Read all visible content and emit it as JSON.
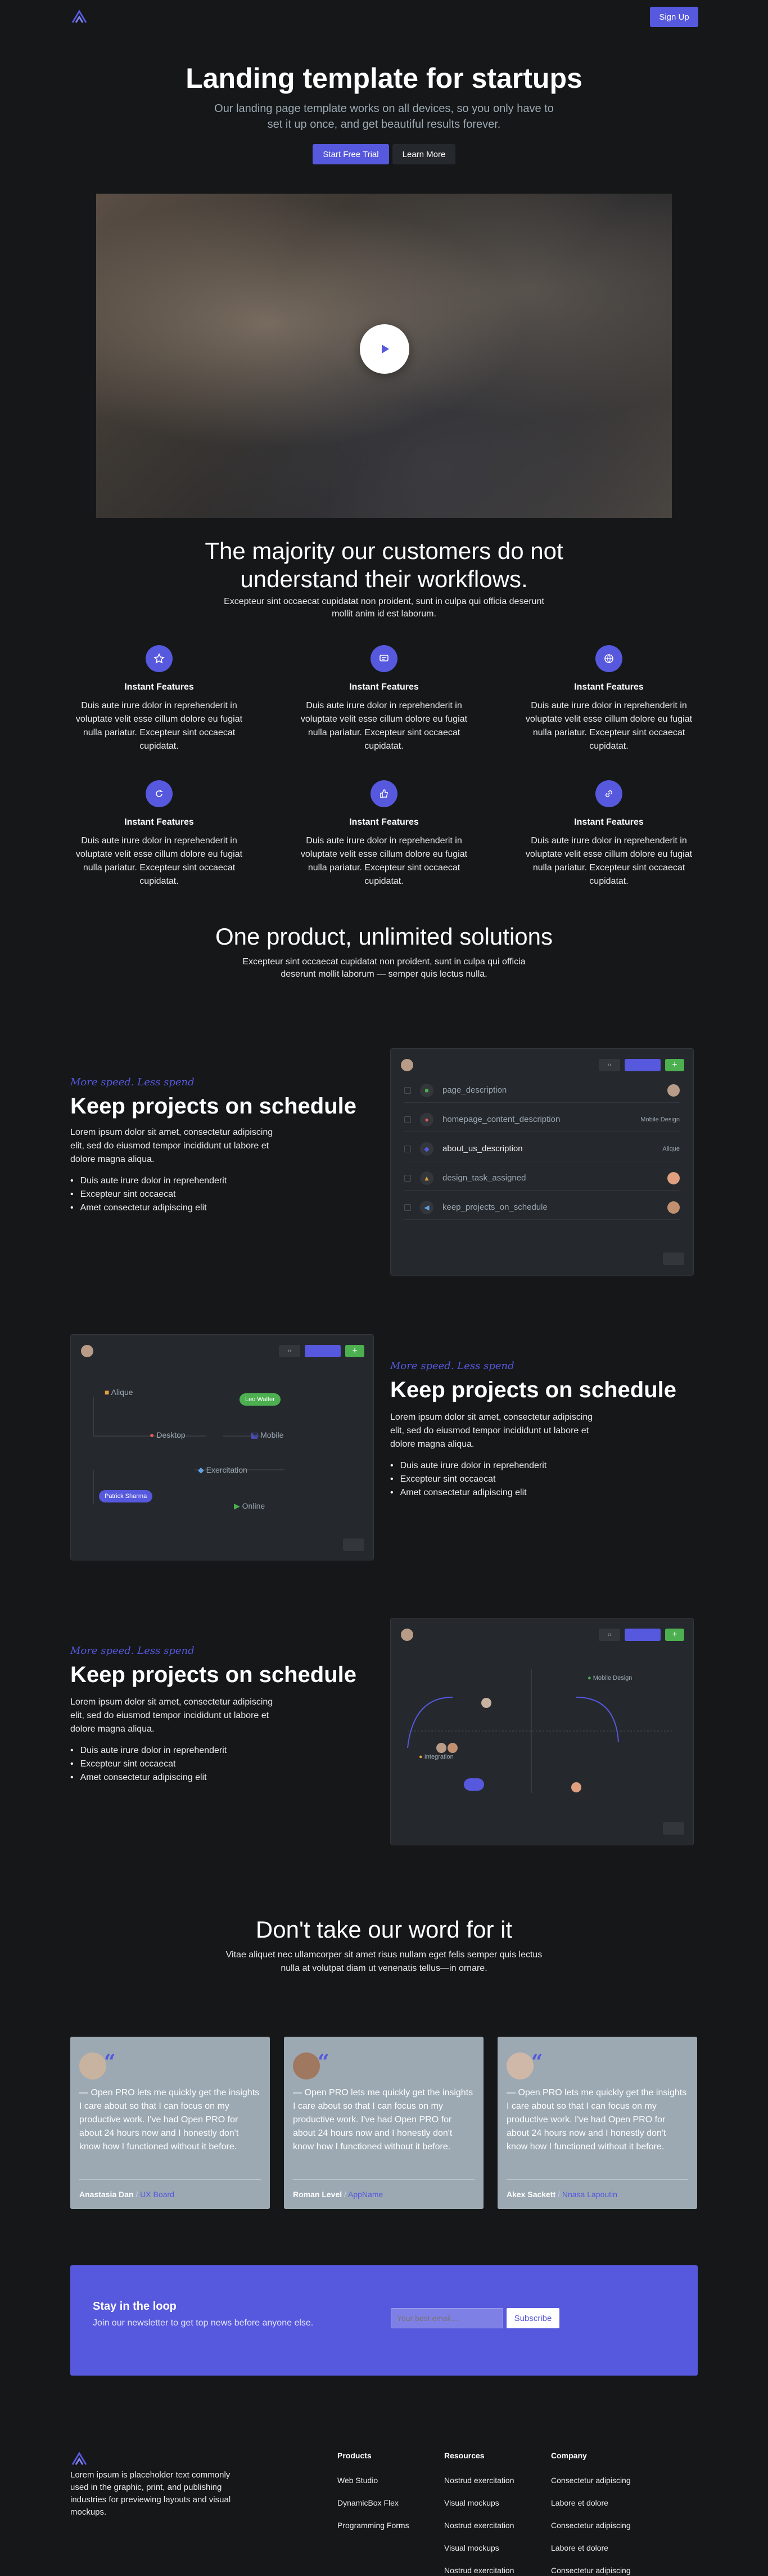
{
  "header": {
    "signup_label": "Sign Up"
  },
  "hero": {
    "title": "Landing template for startups",
    "subtitle_line1": "Our landing page template works on all devices, so you only have to",
    "subtitle_line2": "set it up once, and get beautiful results forever.",
    "cta_primary": "Start Free Trial",
    "cta_secondary": "Learn More"
  },
  "features": {
    "title_line1": "The majority our customers do not",
    "title_line2": "understand their workflows.",
    "desc_line1": "Excepteur sint occaecat cupidatat non proident, sunt in culpa qui officia deserunt",
    "desc_line2": "mollit anim id est laborum.",
    "items": [
      {
        "title": "Instant Features",
        "desc": "Duis aute irure dolor in reprehenderit in voluptate velit esse cillum dolore eu fugiat nulla pariatur. Excepteur sint occaecat cupidatat."
      },
      {
        "title": "Instant Features",
        "desc": "Duis aute irure dolor in reprehenderit in voluptate velit esse cillum dolore eu fugiat nulla pariatur. Excepteur sint occaecat cupidatat."
      },
      {
        "title": "Instant Features",
        "desc": "Duis aute irure dolor in reprehenderit in voluptate velit esse cillum dolore eu fugiat nulla pariatur. Excepteur sint occaecat cupidatat."
      },
      {
        "title": "Instant Features",
        "desc": "Duis aute irure dolor in reprehenderit in voluptate velit esse cillum dolore eu fugiat nulla pariatur. Excepteur sint occaecat cupidatat."
      },
      {
        "title": "Instant Features",
        "desc": "Duis aute irure dolor in reprehenderit in voluptate velit esse cillum dolore eu fugiat nulla pariatur. Excepteur sint occaecat cupidatat."
      },
      {
        "title": "Instant Features",
        "desc": "Duis aute irure dolor in reprehenderit in voluptate velit esse cillum dolore eu fugiat nulla pariatur. Excepteur sint occaecat cupidatat."
      }
    ]
  },
  "solutions": {
    "title": "One product, unlimited solutions",
    "desc_line1": "Excepteur sint occaecat cupidatat non proident, sunt in culpa qui officia",
    "desc_line2": "deserunt mollit laborum — semper quis lectus nulla."
  },
  "splits": [
    {
      "eyebrow": "More speed. Less spend",
      "title": "Keep projects on schedule",
      "p_line1": "Lorem ipsum dolor sit amet, consectetur adipiscing",
      "p_line2": "elit, sed do eiusmod tempor incididunt ut labore et",
      "p_line3": "dolore magna aliqua.",
      "bullets": [
        "Duis aute irure dolor in reprehenderit",
        "Excepteur sint occaecat",
        "Amet consectetur adipiscing elit"
      ]
    },
    {
      "eyebrow": "More speed. Less spend",
      "title": "Keep projects on schedule",
      "p_line1": "Lorem ipsum dolor sit amet, consectetur adipiscing",
      "p_line2": "elit, sed do eiusmod tempor incididunt ut labore et",
      "p_line3": "dolore magna aliqua.",
      "bullets": [
        "Duis aute irure dolor in reprehenderit",
        "Excepteur sint occaecat",
        "Amet consectetur adipiscing elit"
      ]
    },
    {
      "eyebrow": "More speed. Less spend",
      "title": "Keep projects on schedule",
      "p_line1": "Lorem ipsum dolor sit amet, consectetur adipiscing",
      "p_line2": "elit, sed do eiusmod tempor incididunt ut labore et",
      "p_line3": "dolore magna aliqua.",
      "bullets": [
        "Duis aute irure dolor in reprehenderit",
        "Excepteur sint occaecat",
        "Amet consectetur adipiscing elit"
      ]
    }
  ],
  "panel1": {
    "rows": [
      "page_description",
      "homepage_content_description",
      "about_us_description",
      "design_task_assigned",
      "keep_projects_on_schedule"
    ],
    "tag_mobile": "Mobile Design",
    "tag_alique": "Alique"
  },
  "panel2": {
    "node_alique": "Alique",
    "node_desktop": "Desktop",
    "node_mobile": "Mobile",
    "node_exercitation": "Exercitation",
    "node_online": "Online",
    "badge_leo": "Leo Walter",
    "badge_patrick": "Patrick Sharma"
  },
  "panel3": {
    "tag_mobile": "Mobile Design",
    "tag_integration": "Integration"
  },
  "testimonials": {
    "title": "Don't take our word for it",
    "desc_line1": "Vitae aliquet nec ullamcorper sit amet risus nullam eget felis semper quis lectus",
    "desc_line2": "nulla at volutpat diam ut venenatis tellus—in ornare.",
    "items": [
      {
        "quote": "— Open PRO lets me quickly get the insights I care about so that I can focus on my productive work. I've had Open PRO for about 24 hours now and I honestly don't know how I functioned without it before.",
        "name": "Anastasia Dan",
        "company": "UX Board"
      },
      {
        "quote": "— Open PRO lets me quickly get the insights I care about so that I can focus on my productive work. I've had Open PRO for about 24 hours now and I honestly don't know how I functioned without it before.",
        "name": "Roman Level",
        "company": "AppName"
      },
      {
        "quote": "— Open PRO lets me quickly get the insights I care about so that I can focus on my productive work. I've had Open PRO for about 24 hours now and I honestly don't know how I functioned without it before.",
        "name": "Akex Sackett",
        "company": "Nnasa Lapoutin"
      }
    ]
  },
  "newsletter": {
    "title": "Stay in the loop",
    "desc": "Join our newsletter to get top news before anyone else.",
    "placeholder": "Your best email…",
    "button": "Subscribe"
  },
  "footer": {
    "blurb_line1": "Lorem ipsum is placeholder text commonly",
    "blurb_line2": "used in the graphic, print, and publishing",
    "blurb_line3": "industries for previewing layouts and visual",
    "blurb_line4": "mockups.",
    "products": {
      "title": "Products",
      "links": [
        "Web Studio",
        "DynamicBox Flex",
        "Programming Forms"
      ]
    },
    "resources": {
      "title": "Resources",
      "links": [
        "Nostrud exercitation",
        "Visual mockups",
        "Nostrud exercitation",
        "Visual mockups",
        "Nostrud exercitation"
      ]
    },
    "company": {
      "title": "Company",
      "links": [
        "Consectetur adipiscing",
        "Labore et dolore",
        "Consectetur adipiscing",
        "Labore et dolore",
        "Consectetur adipiscing"
      ]
    }
  },
  "colors": {
    "accent": "#5658dd",
    "bg": "#151719",
    "panel": "#25282c",
    "green": "#4caf50"
  }
}
